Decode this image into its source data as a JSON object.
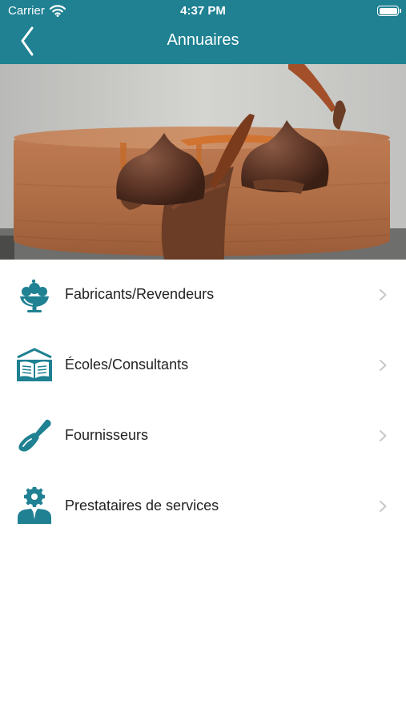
{
  "status_bar": {
    "carrier": "Carrier",
    "time": "4:37 PM"
  },
  "header": {
    "title": "Annuaires",
    "back_icon": "chevron-left-icon",
    "background": "#1f8192"
  },
  "hero_image": {
    "subject": "chocolate-cake-photo"
  },
  "menu": {
    "items": [
      {
        "label": "Fabricants/Revendeurs",
        "icon": "ice-cream-cup-icon"
      },
      {
        "label": "Écoles/Consultants",
        "icon": "open-book-icon"
      },
      {
        "label": "Fournisseurs",
        "icon": "spatula-icon"
      },
      {
        "label": "Prestataires de services",
        "icon": "service-person-gear-icon"
      }
    ],
    "chevron_icon": "chevron-right-icon"
  },
  "colors": {
    "accent": "#1f8192",
    "chevron": "#c7c7cc"
  }
}
